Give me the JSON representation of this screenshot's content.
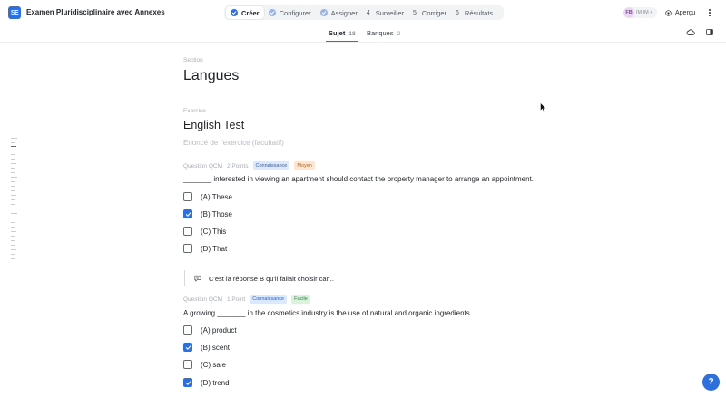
{
  "app": {
    "logo_text": "SE",
    "title": "Examen Pluridisciplinaire avec Annexes"
  },
  "stepper": {
    "steps": [
      {
        "label": "Créer",
        "num": "",
        "state": "active"
      },
      {
        "label": "Configurer",
        "num": "",
        "state": "done"
      },
      {
        "label": "Assigner",
        "num": "",
        "state": "done"
      },
      {
        "label": "Surveiller",
        "num": "4",
        "state": "todo"
      },
      {
        "label": "Corriger",
        "num": "5",
        "state": "todo"
      },
      {
        "label": "Résultats",
        "num": "6",
        "state": "todo"
      }
    ]
  },
  "header_right": {
    "avatar_initials": "FB",
    "avatar_more": "IM IM +",
    "preview_label": "Aperçu"
  },
  "subtabs": [
    {
      "label": "Sujet",
      "count": "18"
    },
    {
      "label": "Banques",
      "count": "2"
    }
  ],
  "section": {
    "kicker": "Section",
    "title": "Langues"
  },
  "exercise": {
    "kicker": "Exercice",
    "title": "English Test",
    "statement_placeholder": "Enoncé de l'exercice (facultatif)"
  },
  "questions": [
    {
      "type": "Question QCM",
      "points": "2 Points",
      "tags": [
        "Connaissance",
        "Moyen"
      ],
      "text": "_______ interested in viewing an apartment should contact the property manager to arrange an appointment.",
      "options": [
        {
          "label": "(A) These",
          "checked": false
        },
        {
          "label": "(B) Those",
          "checked": true
        },
        {
          "label": "(C) This",
          "checked": false
        },
        {
          "label": "(D) That",
          "checked": false
        }
      ],
      "feedback": "C'est la réponse B qu'il fallait choisir car..."
    },
    {
      "type": "Question QCM",
      "points": "1 Point",
      "tags": [
        "Connaissance",
        "Facile"
      ],
      "text": "A growing _______ in the cosmetics industry is the use of natural and organic ingredients.",
      "options": [
        {
          "label": "(A) product",
          "checked": false
        },
        {
          "label": "(B) scent",
          "checked": true
        },
        {
          "label": "(C) sale",
          "checked": false
        },
        {
          "label": "(D) trend",
          "checked": true
        }
      ]
    }
  ],
  "help": {
    "label": "?"
  },
  "colors": {
    "accent": "#2f6fdb",
    "badge_knowledge": "#dde9fb",
    "badge_medium": "#fde7d3",
    "badge_easy": "#dcf1df"
  }
}
